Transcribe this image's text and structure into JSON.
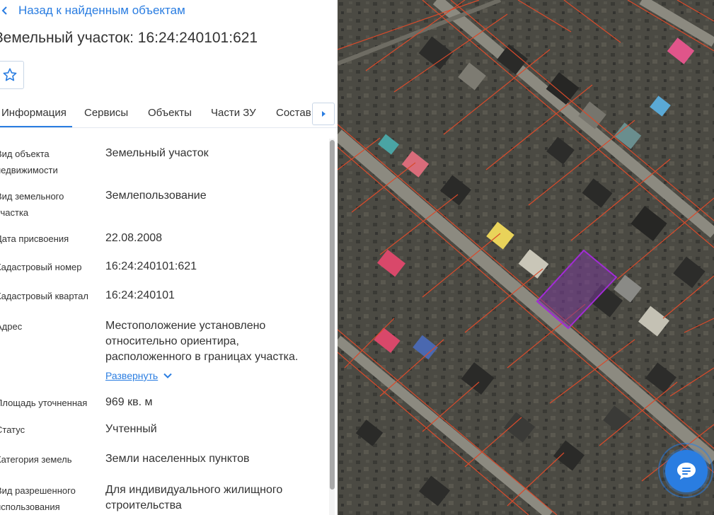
{
  "header": {
    "back_label": "Назад к найденным объектам",
    "title": "Земельный участок: 16:24:240101:621"
  },
  "tabs": [
    {
      "label": "Информация",
      "active": true
    },
    {
      "label": "Сервисы"
    },
    {
      "label": "Объекты"
    },
    {
      "label": "Части ЗУ"
    },
    {
      "label": "Состав"
    }
  ],
  "info": {
    "type_label": "Вид объекта недвижимости",
    "type_value": "Земельный участок",
    "landuse_label": "Вид земельного участка",
    "landuse_value": "Землепользование",
    "date_label": "Дата присвоения",
    "date_value": "22.08.2008",
    "cadnum_label": "Кадастровый номер",
    "cadnum_value": "16:24:240101:621",
    "quarter_label": "Кадастровый квартал",
    "quarter_value": "16:24:240101",
    "address_label": "Адрес",
    "address_value": "Местоположение установлено относительно ориентира, расположенного в границах участка.",
    "expand_label": "Развернуть",
    "area_label": "Площадь уточненная",
    "area_value": "969 кв. м",
    "status_label": "Статус",
    "status_value": "Учтенный",
    "category_label": "Категория земель",
    "category_value": "Земли населенных пунктов",
    "permitted_label": "Вид разрешенного использования",
    "permitted_value": "Для индивидуального жилищного строительства"
  },
  "icons": {
    "back": "chevron-left-icon",
    "favorite": "star-icon",
    "tabs_next": "chevron-right-icon",
    "expand": "chevron-down-icon",
    "chat": "chat-icon"
  },
  "colors": {
    "accent": "#2a7de1",
    "parcel_border": "#d94a2b",
    "selected_parcel": "#a22bd6"
  }
}
